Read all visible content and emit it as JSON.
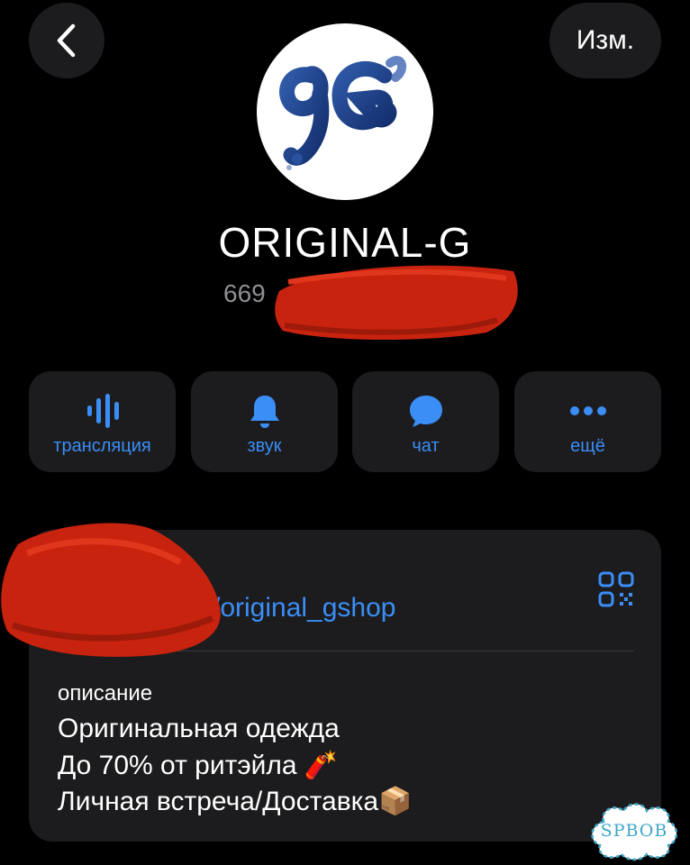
{
  "header": {
    "back_icon": "chevron-left-icon",
    "edit_label": "Изм."
  },
  "profile": {
    "name": "ORIGINAL-G",
    "subscribers_visible": "669"
  },
  "actions": [
    {
      "icon": "waveform-icon",
      "label": "трансляция"
    },
    {
      "icon": "bell-icon",
      "label": "звук"
    },
    {
      "icon": "chat-bubble-icon",
      "label": "чат"
    },
    {
      "icon": "more-dots-icon",
      "label": "ещё"
    }
  ],
  "info": {
    "link": "/original_gshop",
    "qr_icon": "qr-code-icon",
    "description_label": "описание",
    "description_lines": [
      "Оригинальная одежда",
      "До 70% от ритэйла 🧨",
      "Личная встреча/Доставка📦"
    ]
  },
  "watermark": "SPBOB",
  "colors": {
    "accent": "#3a8ef6",
    "background": "#000000",
    "surface": "#1c1c1e",
    "redaction": "#c8230f"
  }
}
